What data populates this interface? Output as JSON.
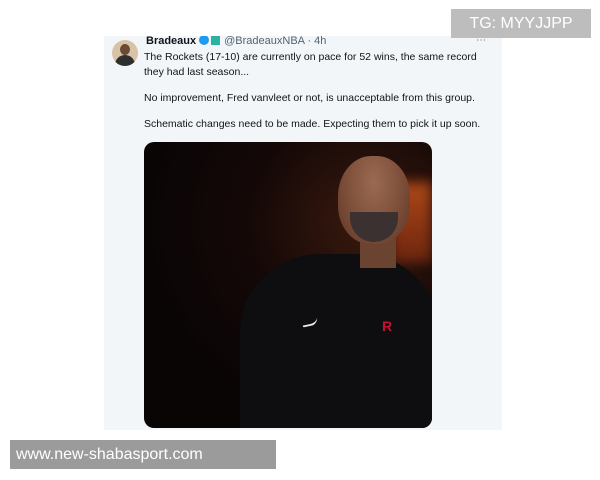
{
  "tweet": {
    "display_name": "Bradeaux",
    "handle": "@BradeauxNBA · 4h",
    "more_symbol": "⋯",
    "paragraphs": [
      "The Rockets (17-10) are currently on pace for 52 wins, the same record they had last season...",
      "No improvement, Fred vanvleet or not, is unacceptable from this group.",
      "Schematic changes need to be made. Expecting them to pick it up soon."
    ],
    "team_logo_glyph": "R"
  },
  "overlays": {
    "telegram_watermark": "TG: MYYJJPP",
    "url_watermark": "www.new-shabasport.com"
  },
  "colors": {
    "verified": "#1d9bf0",
    "rockets_red": "#c8102e",
    "card_bg": "#f3f6f9"
  },
  "icons": [
    "verified-icon",
    "org-badge-icon",
    "more-icon",
    "nike-logo-icon",
    "team-logo-icon"
  ]
}
